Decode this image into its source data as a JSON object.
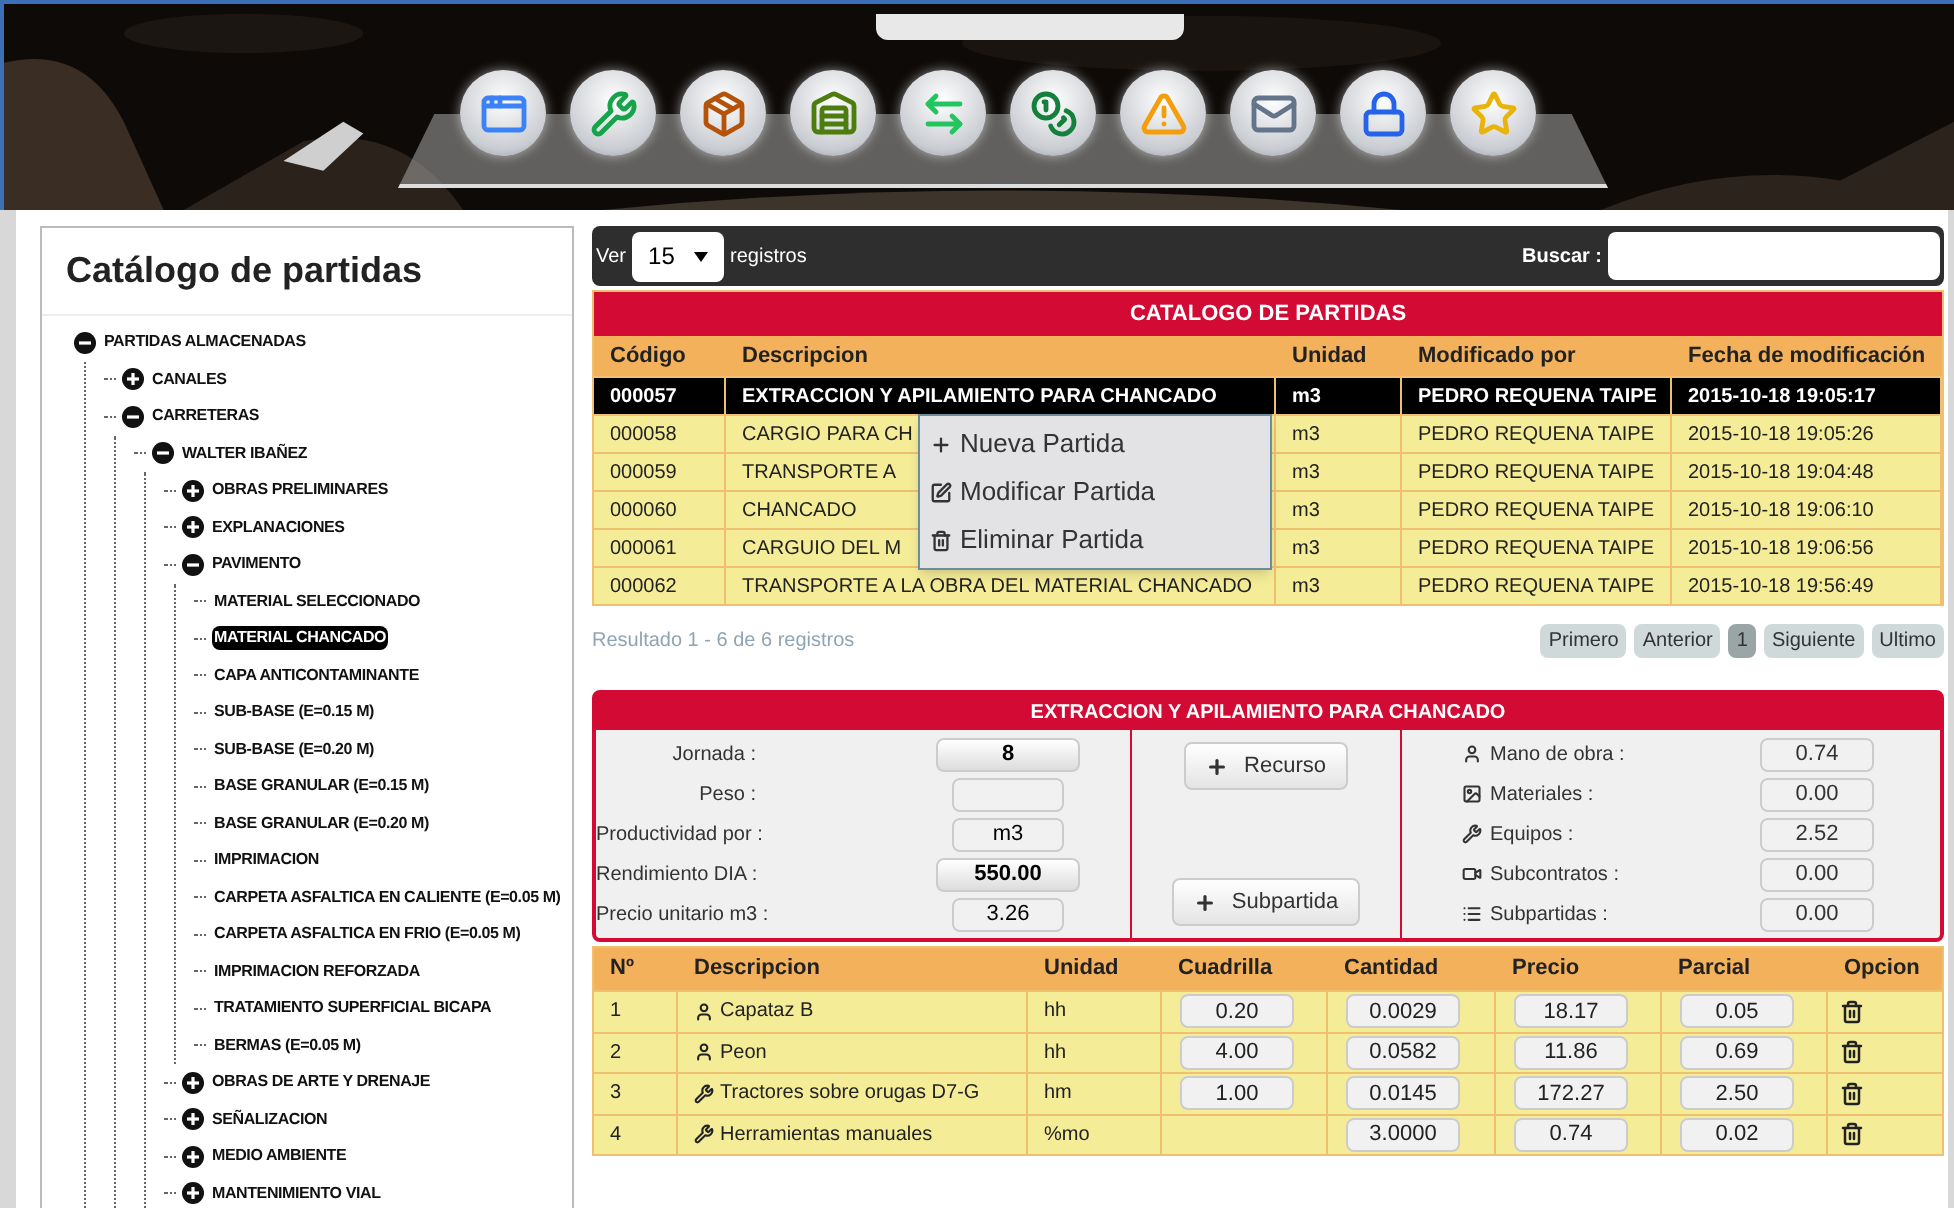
{
  "panel_title": "Catálogo de partidas",
  "tree": [
    {
      "label": "PARTIDAS ALMACENADAS",
      "expanded": true,
      "selected": false,
      "children": [
        {
          "label": "CANALES",
          "expanded": false,
          "selected": false
        },
        {
          "label": "CARRETERAS",
          "expanded": true,
          "selected": false,
          "children": [
            {
              "label": "WALTER IBAÑEZ",
              "expanded": true,
              "selected": false,
              "children": [
                {
                  "label": "OBRAS PRELIMINARES",
                  "expanded": false,
                  "selected": false
                },
                {
                  "label": "EXPLANACIONES",
                  "expanded": false,
                  "selected": false
                },
                {
                  "label": "PAVIMENTO",
                  "expanded": true,
                  "selected": false,
                  "children": [
                    {
                      "label": "MATERIAL SELECCIONADO",
                      "selected": false
                    },
                    {
                      "label": "MATERIAL CHANCADO",
                      "selected": true
                    },
                    {
                      "label": "CAPA ANTICONTAMINANTE",
                      "selected": false
                    },
                    {
                      "label": "SUB-BASE (E=0.15 M)",
                      "selected": false
                    },
                    {
                      "label": "SUB-BASE (E=0.20 M)",
                      "selected": false
                    },
                    {
                      "label": "BASE GRANULAR (E=0.15 M)",
                      "selected": false
                    },
                    {
                      "label": "BASE GRANULAR (E=0.20 M)",
                      "selected": false
                    },
                    {
                      "label": "IMPRIMACION",
                      "selected": false
                    },
                    {
                      "label": "CARPETA ASFALTICA EN CALIENTE (E=0.05 M)",
                      "selected": false
                    },
                    {
                      "label": "CARPETA ASFALTICA EN FRIO (E=0.05 M)",
                      "selected": false
                    },
                    {
                      "label": "IMPRIMACION REFORZADA",
                      "selected": false
                    },
                    {
                      "label": "TRATAMIENTO SUPERFICIAL BICAPA",
                      "selected": false
                    },
                    {
                      "label": "BERMAS (E=0.05 M)",
                      "selected": false
                    }
                  ]
                },
                {
                  "label": "OBRAS DE ARTE Y DRENAJE",
                  "expanded": false,
                  "selected": false
                },
                {
                  "label": "SEÑALIZACION",
                  "expanded": false,
                  "selected": false
                },
                {
                  "label": "MEDIO AMBIENTE",
                  "expanded": false,
                  "selected": false
                },
                {
                  "label": "MANTENIMIENTO VIAL",
                  "expanded": false,
                  "selected": false
                }
              ]
            }
          ]
        }
      ]
    }
  ],
  "toolbar": {
    "show_label": "Ver",
    "page_size": "15",
    "records_label": "registros",
    "search_label": "Buscar :"
  },
  "catalog": {
    "title": "CATALOGO DE PARTIDAS",
    "columns": [
      "Código",
      "Descripcion",
      "Unidad",
      "Modificado por",
      "Fecha de modificación"
    ],
    "rows": [
      {
        "selected": true,
        "cells": [
          "000057",
          "EXTRACCION Y APILAMIENTO PARA CHANCADO",
          "m3",
          "PEDRO REQUENA TAIPE",
          "2015-10-18 19:05:17"
        ]
      },
      {
        "selected": false,
        "cells": [
          "000058",
          "CARGIO PARA CH",
          "m3",
          "PEDRO REQUENA TAIPE",
          "2015-10-18 19:05:26"
        ]
      },
      {
        "selected": false,
        "cells": [
          "000059",
          "TRANSPORTE A",
          "m3",
          "PEDRO REQUENA TAIPE",
          "2015-10-18 19:04:48"
        ]
      },
      {
        "selected": false,
        "cells": [
          "000060",
          "CHANCADO",
          "m3",
          "PEDRO REQUENA TAIPE",
          "2015-10-18 19:06:10"
        ]
      },
      {
        "selected": false,
        "cells": [
          "000061",
          "CARGUIO DEL M",
          "m3",
          "PEDRO REQUENA TAIPE",
          "2015-10-18 19:06:56"
        ]
      },
      {
        "selected": false,
        "cells": [
          "000062",
          "TRANSPORTE A LA OBRA DEL MATERIAL CHANCADO",
          "m3",
          "PEDRO REQUENA TAIPE",
          "2015-10-18 19:56:49"
        ]
      }
    ],
    "result": "Resultado 1 - 6 de 6 registros",
    "pagination": [
      {
        "label": "Primero",
        "selected": false
      },
      {
        "label": "Anterior",
        "selected": false
      },
      {
        "label": "1",
        "selected": true
      },
      {
        "label": "Siguiente",
        "selected": false
      },
      {
        "label": "Ultimo",
        "selected": false
      }
    ]
  },
  "context_menu": [
    {
      "kind": "add",
      "label": "Nueva Partida"
    },
    {
      "kind": "edit",
      "label": "Modificar Partida"
    },
    {
      "kind": "delete",
      "label": "Eliminar Partida"
    }
  ],
  "detail": {
    "title": "EXTRACCION Y APILAMIENTO PARA CHANCADO",
    "fields": [
      {
        "label": "Jornada :",
        "value": "8",
        "kind": "editable"
      },
      {
        "label": "Peso :",
        "kind": "readonly"
      },
      {
        "label": "Productividad por :",
        "value": "m3",
        "kind": "readonly"
      },
      {
        "label": "Rendimiento DIA :",
        "value": "550.00",
        "kind": "editable"
      },
      {
        "label": "Precio unitario m3 :",
        "value": "3.26",
        "kind": "readonly"
      }
    ],
    "buttons": [
      "Recurso",
      "Subpartida"
    ],
    "summary": [
      {
        "kind": "labor",
        "label": "Mano de obra :",
        "value": "0.74"
      },
      {
        "kind": "materials",
        "label": "Materiales :",
        "value": "0.00"
      },
      {
        "kind": "equipment",
        "label": "Equipos :",
        "value": "2.52"
      },
      {
        "kind": "subcontracts",
        "label": "Subcontratos :",
        "value": "0.00"
      },
      {
        "kind": "subitems",
        "label": "Subpartidas :",
        "value": "0.00"
      }
    ]
  },
  "resources": {
    "columns": [
      "Nº",
      "Descripcion",
      "Unidad",
      "Cuadrilla",
      "Cantidad",
      "Precio",
      "Parcial",
      "Opcion"
    ],
    "rows": [
      {
        "kind": "labor",
        "no": "1",
        "description": "Capataz B",
        "unit": "hh",
        "crew": "0.20",
        "quantity": "0.0029",
        "price": "18.17",
        "partial": "0.05"
      },
      {
        "kind": "labor",
        "no": "2",
        "description": "Peon",
        "unit": "hh",
        "crew": "4.00",
        "quantity": "0.0582",
        "price": "11.86",
        "partial": "0.69"
      },
      {
        "kind": "equipment",
        "no": "3",
        "description": "Tractores sobre orugas D7-G",
        "unit": "hm",
        "crew": "1.00",
        "quantity": "0.0145",
        "price": "172.27",
        "partial": "2.50"
      },
      {
        "kind": "equipment",
        "no": "4",
        "description": "Herramientas manuales",
        "unit": "%mo",
        "quantity": "3.0000",
        "price": "0.74",
        "partial": "0.02"
      }
    ]
  }
}
